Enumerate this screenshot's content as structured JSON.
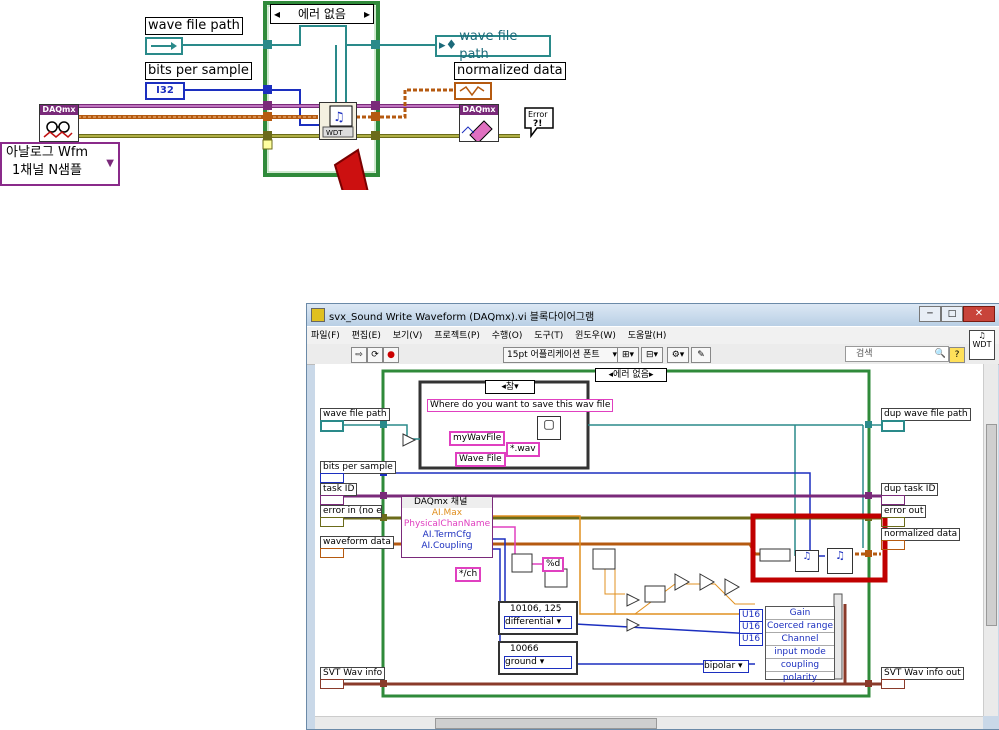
{
  "top_diagram": {
    "case_selector": "에러 없음",
    "controls": {
      "wave_file_path": "wave file path",
      "bits_per_sample": "bits per sample",
      "bits_type": "I32",
      "normalized_data": "normalized data",
      "wave_file_path_out": "wave file path",
      "analog_menu_line1": "아날로그 Wfm",
      "analog_menu_line2": "1채널 N샘플"
    },
    "icons": {
      "daqmx_label": "DAQmx",
      "wdt_label": "WDT",
      "error_label": "Error",
      "error_mark": "?!"
    }
  },
  "window": {
    "title": "svx_Sound Write Waveform (DAQmx).vi 블록다이어그램",
    "menu": [
      "파일(F)",
      "편집(E)",
      "보기(V)",
      "프로젝트(P)",
      "수행(O)",
      "도구(T)",
      "윈도우(W)",
      "도움말(H)"
    ],
    "font_select": "15pt 어플리케이션 폰트",
    "search_placeholder": "검색",
    "case_selector": "에러 없음",
    "inner_case": "참",
    "prompt_text": "Where do you want to save this wav file",
    "my_wav_file": "myWavFile",
    "wav_ext": "*.wav",
    "wave_file": "Wave File",
    "per_ch": "*/ch",
    "fmt_d": "%d",
    "enum1": "10106, 125",
    "enum1_sel": "differential",
    "enum2": "10066",
    "enum2_sel": "ground",
    "bipolar": "bipolar",
    "u16": "U16",
    "property_node_title": "DAQmx 채널",
    "property_items": [
      "AI.Max",
      "PhysicalChanName",
      "AI.TermCfg",
      "AI.Coupling"
    ],
    "bundle_items": [
      "Gain",
      "Coerced range",
      "Channel",
      "input mode",
      "coupling",
      "polarity"
    ],
    "left_terminals": [
      "wave file path",
      "bits per sample",
      "task ID",
      "error in (no erro",
      "waveform data",
      "SVT Wav info"
    ],
    "right_terminals": [
      "dup wave file path",
      "dup task ID",
      "error out",
      "normalized data",
      "SVT Wav info out"
    ],
    "highlight_color": "#c00000"
  }
}
